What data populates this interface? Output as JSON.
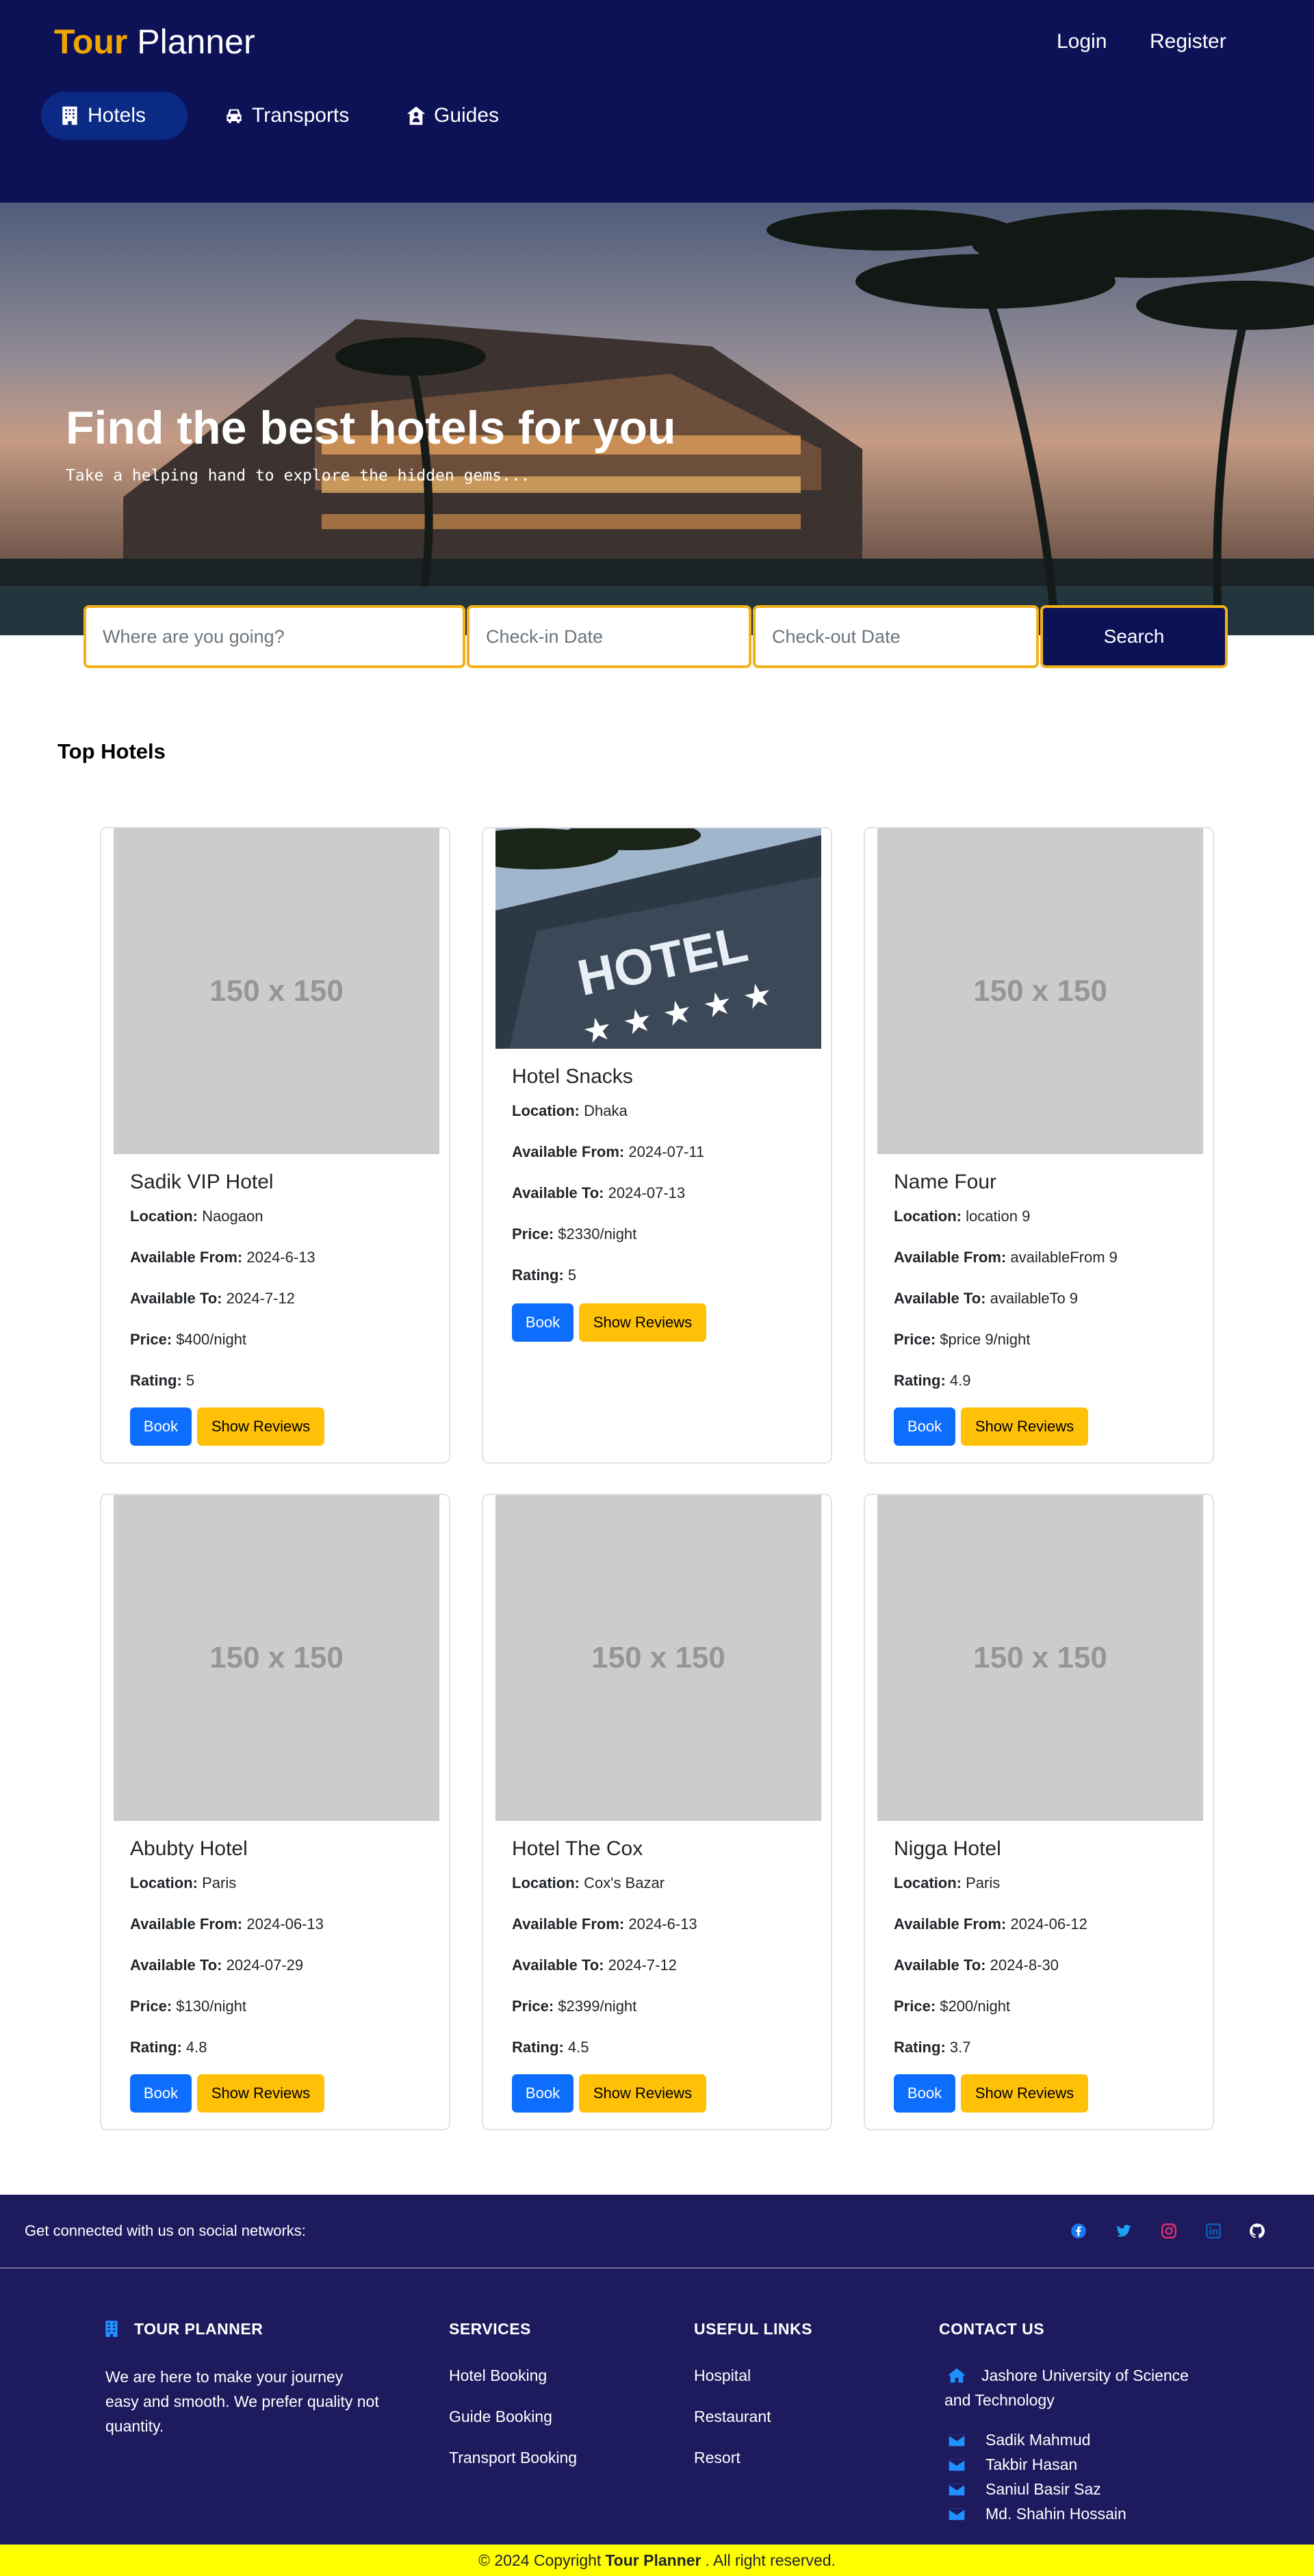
{
  "header": {
    "logo_brand": "Tour",
    "logo_rest": " Planner",
    "login": "Login",
    "register": "Register",
    "tabs": [
      {
        "label": "Hotels",
        "icon": "hotel-icon",
        "active": true
      },
      {
        "label": "Transports",
        "icon": "car-icon",
        "active": false
      },
      {
        "label": "Guides",
        "icon": "guide-icon",
        "active": false
      }
    ]
  },
  "hero": {
    "title": "Find the best hotels for you",
    "subtitle": "Take a helping hand to explore the hidden gems..."
  },
  "search": {
    "destination_placeholder": "Where are you going?",
    "checkin_placeholder": "Check-in Date",
    "checkout_placeholder": "Check-out Date",
    "button": "Search"
  },
  "section_title": "Top Hotels",
  "hotels": [
    {
      "name": "Sadik VIP Hotel",
      "location": "Naogaon",
      "available_from": "2024-6-13",
      "available_to": "2024-7-12",
      "price": "$400/night",
      "rating": "5",
      "image": "150 x 150"
    },
    {
      "name": "Hotel Snacks",
      "location": "Dhaka",
      "available_from": "2024-07-11",
      "available_to": "2024-07-13",
      "price": "$2330/night",
      "rating": "5",
      "image": "HOTEL"
    },
    {
      "name": "Name Four",
      "location": "location 9",
      "available_from": "availableFrom 9",
      "available_to": "availableTo 9",
      "price": "$price 9/night",
      "rating": "4.9",
      "image": "150 x 150"
    },
    {
      "name": "Abubty Hotel",
      "location": "Paris",
      "available_from": "2024-06-13",
      "available_to": "2024-07-29",
      "price": "$130/night",
      "rating": "4.8",
      "image": "150 x 150"
    },
    {
      "name": "Hotel The Cox",
      "location": "Cox's Bazar",
      "available_from": "2024-6-13",
      "available_to": "2024-7-12",
      "price": "$2399/night",
      "rating": "4.5",
      "image": "150 x 150"
    },
    {
      "name": "Nigga Hotel",
      "location": "Paris",
      "available_from": "2024-06-12",
      "available_to": "2024-8-30",
      "price": "$200/night",
      "rating": "3.7",
      "image": "150 x 150"
    }
  ],
  "labels": {
    "location": "Location:",
    "available_from": "Available From:",
    "available_to": "Available To:",
    "price": "Price:",
    "rating": "Rating:",
    "book": "Book",
    "show_reviews": "Show Reviews"
  },
  "footer": {
    "social_text": "Get connected with us on social networks:",
    "social_icons": [
      {
        "name": "facebook-icon",
        "color": "#1877f2"
      },
      {
        "name": "twitter-icon",
        "color": "#1da1f2"
      },
      {
        "name": "instagram-icon",
        "color": "#e1306c"
      },
      {
        "name": "linkedin-icon",
        "color": "#0a66c2"
      },
      {
        "name": "github-icon",
        "color": "#ffffff"
      }
    ],
    "about_title": "TOUR PLANNER",
    "about_text": "We are here to make your journey easy and smooth. We prefer quality not quantity.",
    "services_title": "SERVICES",
    "services": [
      "Hotel Booking",
      "Guide Booking",
      "Transport Booking"
    ],
    "useful_title": "USEFUL LINKS",
    "useful_links": [
      "Hospital",
      "Restaurant",
      "Resort"
    ],
    "contact_title": "CONTACT US",
    "address": "Jashore University of Science and Technology",
    "contacts": [
      "Sadik Mahmud",
      "Takbir Hasan",
      "Saniul Basir Saz",
      "Md. Shahin Hossain"
    ],
    "accent": "#1e90ff"
  },
  "copyright": {
    "prefix": "© 2024 Copyright",
    "brand": "Tour Planner",
    "suffix": ". All right reserved."
  },
  "colors": {
    "header_bg": "#0d1257",
    "brand": "#f0a500",
    "footer_bg": "#1e1a5e",
    "copyright_bg": "#ffff00",
    "book_btn": "#0d6efd",
    "reviews_btn": "#ffc107"
  }
}
